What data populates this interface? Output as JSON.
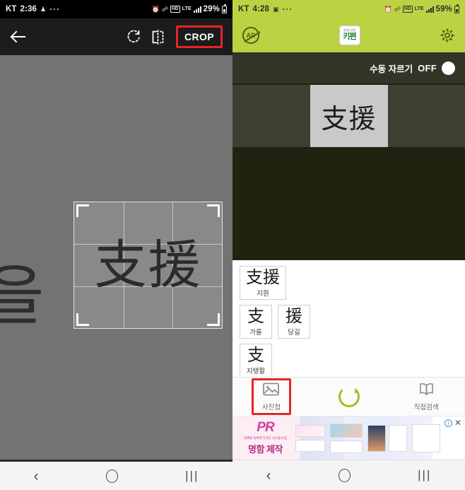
{
  "left_phone": {
    "statusbar": {
      "carrier": "KT",
      "time": "2:36",
      "dots": "···",
      "hd": "HD",
      "lte": "LTE",
      "battery_percent": "29%"
    },
    "toolbar": {
      "back_icon": "arrow-back-icon",
      "rotate_icon": "rotate-right-icon",
      "flip_icon": "flip-horizontal-icon",
      "crop_label": "CROP",
      "crop_highlight_color": "#e8232a"
    },
    "canvas": {
      "background_partial_char": "을",
      "crop_content": "支援",
      "overlay_name": "crop-overlay"
    },
    "navbar": {
      "back": "‹",
      "home": "○",
      "recents": "|||"
    }
  },
  "right_phone": {
    "statusbar": {
      "carrier": "KT",
      "time": "4:28",
      "dots": "···",
      "hd": "HD",
      "lte": "LTE",
      "battery_percent": "59%"
    },
    "header": {
      "background_color": "#bcd243",
      "ad_button_label": "AD",
      "logo_top": "한자사전",
      "logo_main": "키편",
      "settings_icon": "gear-icon"
    },
    "manual_crop": {
      "label": "수동 자르기",
      "state": "OFF"
    },
    "preview": {
      "recognized_text": "支援"
    },
    "results": [
      [
        {
          "hanja": "支援",
          "korean": "지원"
        }
      ],
      [
        {
          "hanja": "支",
          "korean": "가를"
        },
        {
          "hanja": "援",
          "korean": "당길"
        }
      ],
      [
        {
          "hanja": "支",
          "korean": "지탱할"
        }
      ]
    ],
    "tabs": [
      {
        "label": "사진첩",
        "icon": "photo-album-icon",
        "highlighted": true
      },
      {
        "label": "",
        "icon": "refresh-icon",
        "highlighted": false
      },
      {
        "label": "직접검색",
        "icon": "book-icon",
        "highlighted": false
      }
    ],
    "ad_banner": {
      "logo": "PR",
      "logo_suffix": "커상업",
      "tagline": "업께일 독특한 디자인 시스템 보임",
      "headline": "명함 제작",
      "info_icon": "info-icon",
      "close_icon": "close-icon"
    },
    "navbar": {
      "back": "‹",
      "home": "○",
      "recents": "|||"
    }
  }
}
